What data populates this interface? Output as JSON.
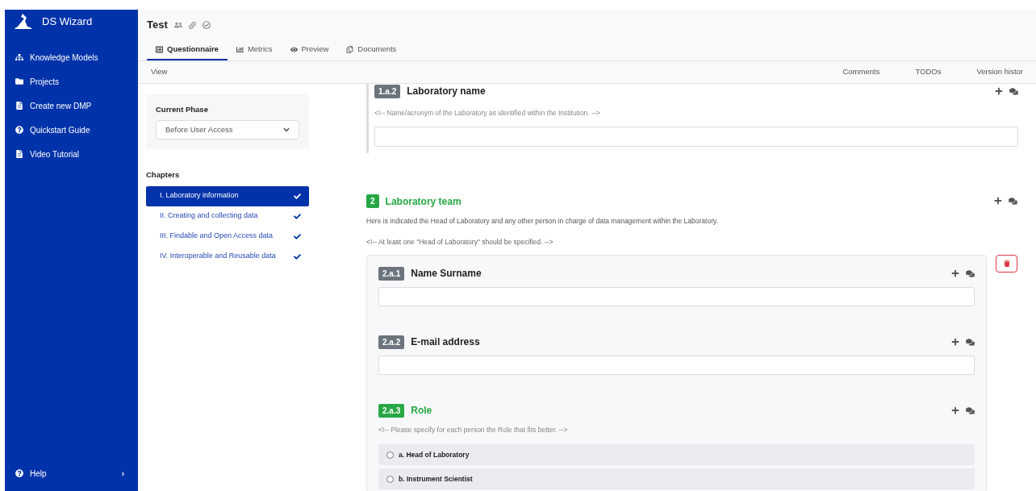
{
  "sidebar": {
    "app_name": "DS Wizard",
    "items": [
      {
        "label": "Knowledge Models"
      },
      {
        "label": "Projects"
      },
      {
        "label": "Create new DMP"
      },
      {
        "label": "Quickstart Guide"
      },
      {
        "label": "Video Tutorial"
      }
    ],
    "help": {
      "label": "Help",
      "chevron": "›"
    }
  },
  "project": {
    "title": "Test"
  },
  "tabs": [
    {
      "label": "Questionnaire",
      "selected": true
    },
    {
      "label": "Metrics",
      "selected": false
    },
    {
      "label": "Preview",
      "selected": false
    },
    {
      "label": "Documents",
      "selected": false
    }
  ],
  "toolbar": {
    "left": [
      "View"
    ],
    "right": [
      "Comments",
      "TODOs",
      "Version histor"
    ]
  },
  "phase": {
    "label": "Current Phase",
    "value": "Before User Access"
  },
  "chapters": {
    "heading": "Chapters",
    "items": [
      {
        "label": "I. Laboratory information",
        "selected": true,
        "checked": true
      },
      {
        "label": "II. Creating and collecting data",
        "selected": false,
        "checked": true
      },
      {
        "label": "III. Findable and Open Access data",
        "selected": false,
        "checked": true
      },
      {
        "label": "IV. Interoperable and Reusable data",
        "selected": false,
        "checked": true
      }
    ]
  },
  "previous_question": {
    "number": "1.a.2",
    "title": "Laboratory name",
    "answered": false,
    "hint": "<!-- Name/acronym of the Laboratory as identified within the Institution. -->"
  },
  "group": {
    "number": "2",
    "title": "Laboratory team",
    "answered": true,
    "description": "Here is indicated the Head of Laboratory and any other person in charge of data management within the Laboratory.",
    "hint": "<!-- At least one \"Head of Laboratory\" should be specified. -->",
    "questions": [
      {
        "kind": "text",
        "number": "2.a.1",
        "title": "Name Surname",
        "answered": false
      },
      {
        "kind": "text",
        "number": "2.a.2",
        "title": "E-mail address",
        "answered": false
      },
      {
        "kind": "choice",
        "number": "2.a.3",
        "title": "Role",
        "answered": true,
        "hint": "<!-- Please specify for each person the Role that fits better. -->",
        "options": [
          {
            "label": "a. Head of Laboratory",
            "selected": false
          },
          {
            "label": "b. Instrument Scientist",
            "selected": false
          }
        ]
      }
    ]
  }
}
